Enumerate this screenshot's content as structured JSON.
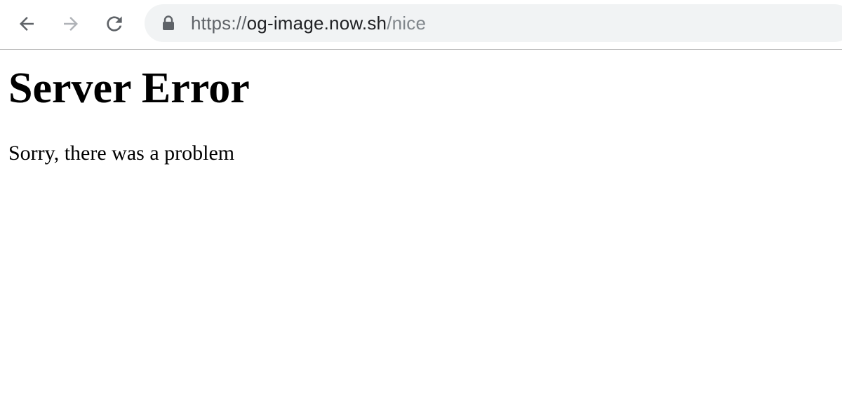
{
  "browser": {
    "back_icon": "arrow-left-icon",
    "forward_icon": "arrow-right-icon",
    "reload_icon": "reload-icon",
    "lock_icon": "lock-icon",
    "url": {
      "scheme": "https://",
      "host": "og-image.now.sh",
      "path": "/nice"
    },
    "colors": {
      "toolbar_bg": "#ffffff",
      "omnibox_bg": "#f1f3f4",
      "icon_active": "#5f6368",
      "icon_disabled": "#b0b3b8"
    }
  },
  "page": {
    "title": "Server Error",
    "message": "Sorry, there was a problem"
  }
}
